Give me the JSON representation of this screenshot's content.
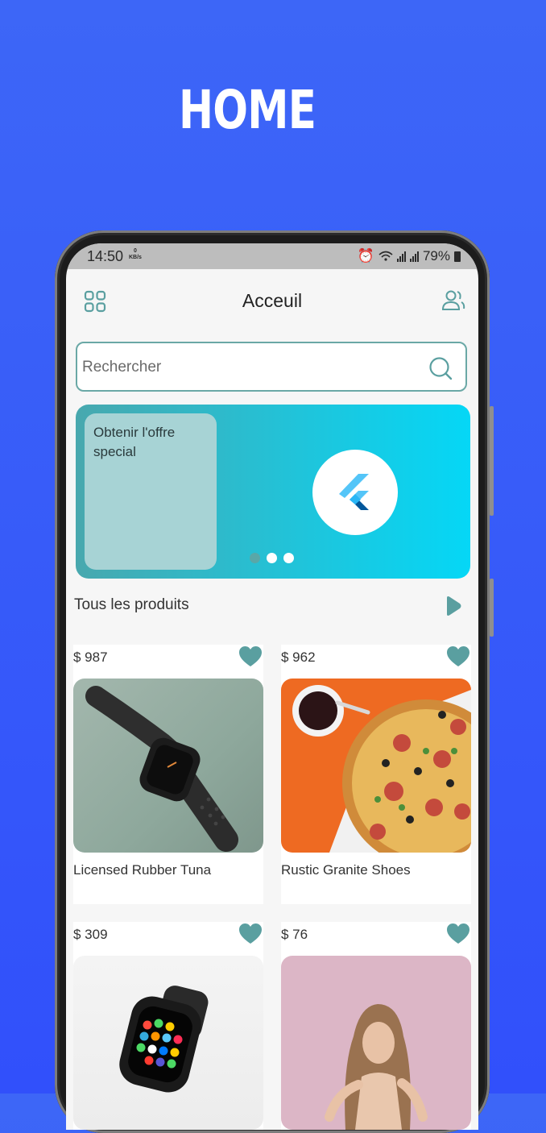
{
  "hero": {
    "title": "HOME"
  },
  "status_bar": {
    "time": "14:50",
    "kb_value": "0",
    "kb_unit": "KB/s",
    "battery": "79%"
  },
  "header": {
    "title": "Acceuil",
    "left_icon": "grid-icon",
    "right_icon": "users-icon"
  },
  "search": {
    "placeholder": "Rechercher",
    "value": ""
  },
  "banner": {
    "offer_text": "Obtenir l'offre special",
    "logo": "flutter-logo",
    "active_dot": 0,
    "dot_count": 3
  },
  "section": {
    "title": "Tous les produits"
  },
  "products": [
    {
      "price": "$ 987",
      "name": "Licensed Rubber Tuna",
      "image": "black sport watch on green cloth"
    },
    {
      "price": "$ 962",
      "name": "Rustic Granite Shoes",
      "image": "pizza on orange background"
    },
    {
      "price": "$ 309",
      "name": "",
      "image": "smartwatch on white background"
    },
    {
      "price": "$ 76",
      "name": "",
      "image": "woman with long curly hair on pink background"
    }
  ],
  "colors": {
    "accent": "#5a9fa0",
    "page_background": "#3d5ef8",
    "banner_gradient_end": "#05d7f6"
  }
}
